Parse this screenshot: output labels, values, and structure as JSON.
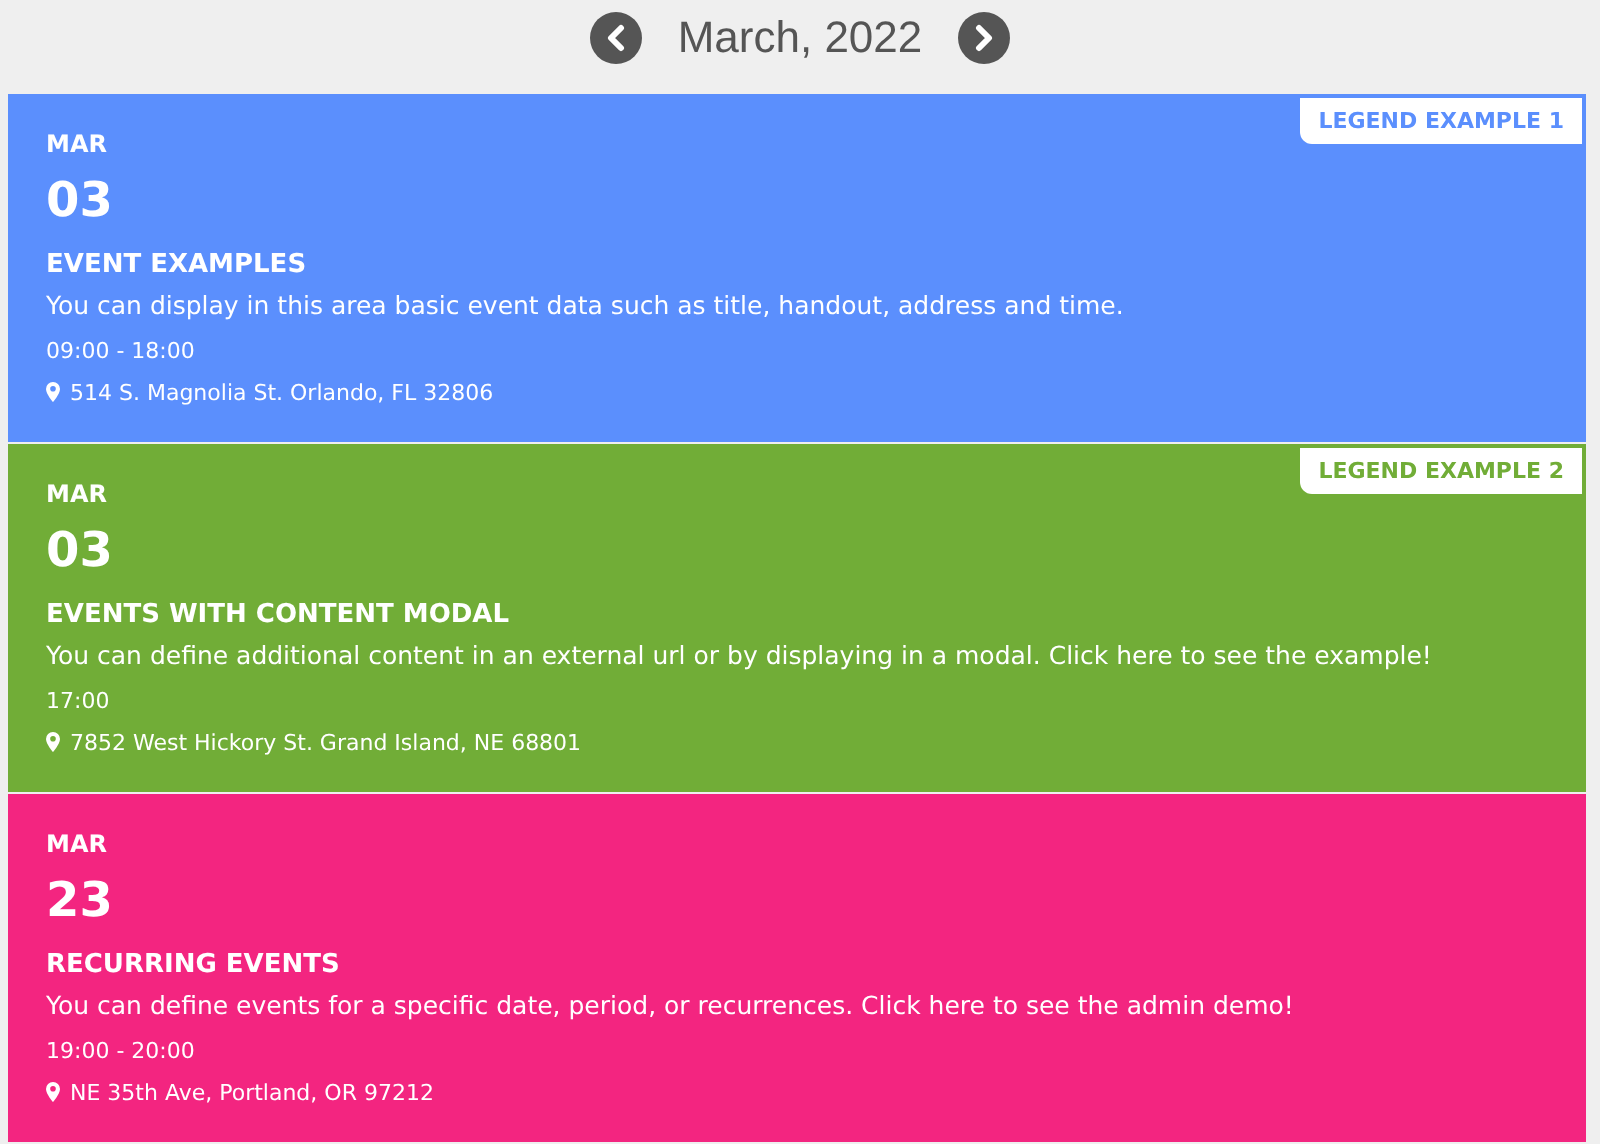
{
  "header": {
    "month_title": "March, 2022"
  },
  "events": [
    {
      "month": "MAR",
      "day": "03",
      "title": "EVENT EXAMPLES",
      "description": "You can display in this area basic event data such as title, handout, address and time.",
      "time": "09:00 - 18:00",
      "address": "514 S. Magnolia St. Orlando, FL 32806",
      "color": "#5b8ffd",
      "legend": "LEGEND EXAMPLE 1"
    },
    {
      "month": "MAR",
      "day": "03",
      "title": "EVENTS WITH CONTENT MODAL",
      "description": "You can define additional content in an external url or by displaying in a modal. Click here to see the example!",
      "time": "17:00",
      "address": "7852 West Hickory St. Grand Island, NE 68801",
      "color": "#71ad37",
      "legend": "LEGEND EXAMPLE 2"
    },
    {
      "month": "MAR",
      "day": "23",
      "title": "RECURRING EVENTS",
      "description": "You can define events for a specific date, period, or recurrences. Click here to see the admin demo!",
      "time": "19:00 - 20:00",
      "address": "NE 35th Ave, Portland, OR 97212",
      "color": "#f32580"
    }
  ]
}
